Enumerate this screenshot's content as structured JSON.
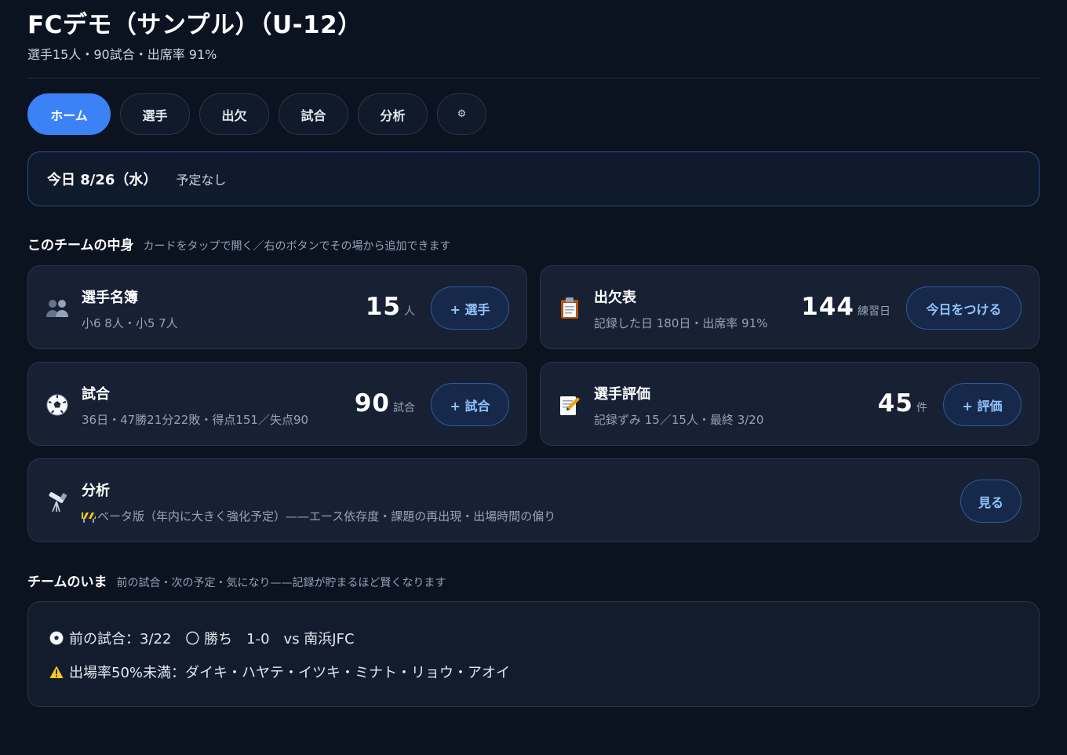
{
  "header": {
    "title": "FCデモ（サンプル）（U-12）",
    "subtitle": "選手15人・90試合・出席率 91%"
  },
  "tabs": [
    {
      "label": "ホーム",
      "active": true
    },
    {
      "label": "選手",
      "active": false
    },
    {
      "label": "出欠",
      "active": false
    },
    {
      "label": "試合",
      "active": false
    },
    {
      "label": "分析",
      "active": false
    },
    {
      "label": "⚙",
      "icon": "gear-icon",
      "active": false
    }
  ],
  "today": {
    "date": "今日 8/26（水）",
    "note": "予定なし"
  },
  "contents_section": {
    "title": "このチームの中身",
    "desc": "カードをタップで開く／右のボタンでその場から追加できます"
  },
  "cards": {
    "roster": {
      "icon": "people-icon",
      "title": "選手名簿",
      "sub": "小6 8人・小5 7人",
      "count": "15",
      "unit": "人",
      "button": "+ 選手"
    },
    "attendance": {
      "icon": "clipboard-icon",
      "title": "出欠表",
      "sub": "記録した日 180日・出席率 91%",
      "count": "144",
      "unit": "練習日",
      "button": "今日をつける"
    },
    "matches": {
      "icon": "soccer-ball-icon",
      "title": "試合",
      "sub": "36日・47勝21分22敗・得点151／失点90",
      "count": "90",
      "unit": "試合",
      "button": "+ 試合"
    },
    "evaluation": {
      "icon": "memo-icon",
      "title": "選手評価",
      "sub": "記録ずみ 15／15人・最終 3/20",
      "count": "45",
      "unit": "件",
      "button": "+ 評価"
    },
    "analysis": {
      "icon": "telescope-icon",
      "title": "分析",
      "sub": "ベータ版（年内に大きく強化予定）——エース依存度・課題の再出現・出場時間の偏り",
      "sub_icon": "construction-icon",
      "button": "見る"
    }
  },
  "now_section": {
    "title": "チームのいま",
    "desc": "前の試合・次の予定・気になり——記録が貯まるほど賢くなります"
  },
  "status": {
    "last_match": "前の試合：3/22　〇 勝ち　1-0　vs 南浜JFC",
    "warning": "出場率50%未満：ダイキ・ハヤテ・イツキ・ミナト・リョウ・アオイ"
  },
  "colors": {
    "background": "#0b1220",
    "accent": "#3b82f6",
    "card": "#172133",
    "pill_text": "#93c5fd",
    "warning": "#facc15"
  }
}
